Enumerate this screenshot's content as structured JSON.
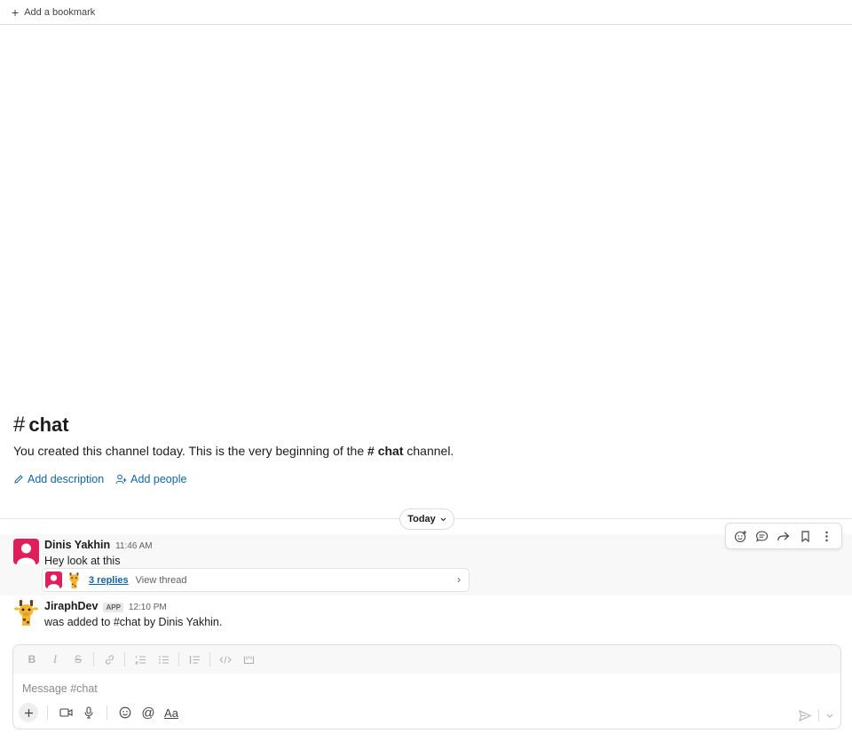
{
  "bookmarks": {
    "add_label": "Add a bookmark"
  },
  "channel": {
    "name": "chat",
    "intro_prefix": "You created this channel today. This is the very beginning of the",
    "intro_suffix": "channel.",
    "add_description": "Add description",
    "add_people": "Add people"
  },
  "divider": {
    "label": "Today"
  },
  "messages": [
    {
      "author": "Dinis Yakhin",
      "time": "11:46 AM",
      "text": "Hey look at this",
      "thread": {
        "replies": "3 replies",
        "view": "View thread"
      }
    },
    {
      "author": "JiraphDev",
      "badge": "APP",
      "time": "12:10 PM",
      "text": "was added to #chat by Dinis Yakhin."
    }
  ],
  "composer": {
    "placeholder": "Message #chat"
  },
  "colors": {
    "link": "#1264a3",
    "avatar_pink": "#e01e5a",
    "giraffe": "#f2b632"
  }
}
